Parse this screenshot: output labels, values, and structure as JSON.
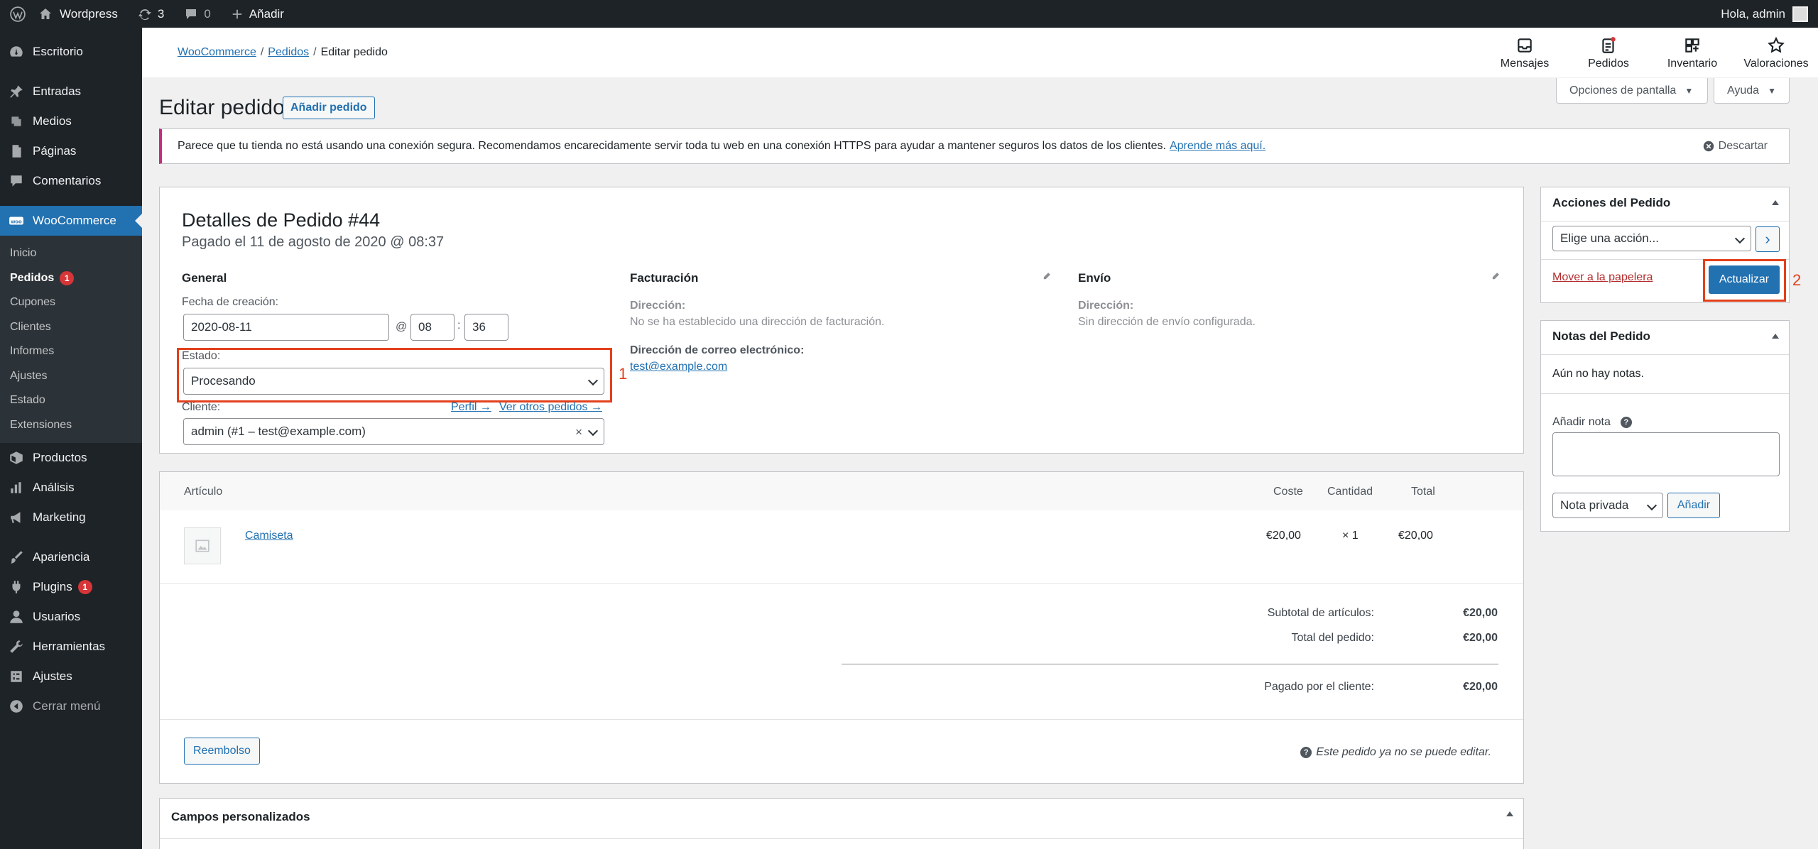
{
  "adminbar": {
    "site_name": "Wordpress",
    "updates_count": "3",
    "comments_count": "0",
    "new_label": "Añadir",
    "greeting": "Hola, admin"
  },
  "sidebar": {
    "items": [
      {
        "label": "Escritorio",
        "icon": "dashboard-icon"
      },
      {
        "label": "Entradas",
        "icon": "pin-icon"
      },
      {
        "label": "Medios",
        "icon": "media-icon"
      },
      {
        "label": "Páginas",
        "icon": "page-icon"
      },
      {
        "label": "Comentarios",
        "icon": "comment-icon"
      },
      {
        "label": "WooCommerce",
        "icon": "woo-icon"
      },
      {
        "label": "Productos",
        "icon": "box-icon"
      },
      {
        "label": "Análisis",
        "icon": "chart-icon"
      },
      {
        "label": "Marketing",
        "icon": "megaphone-icon"
      },
      {
        "label": "Apariencia",
        "icon": "brush-icon"
      },
      {
        "label": "Plugins",
        "icon": "plug-icon",
        "badge": "1"
      },
      {
        "label": "Usuarios",
        "icon": "user-icon"
      },
      {
        "label": "Herramientas",
        "icon": "wrench-icon"
      },
      {
        "label": "Ajustes",
        "icon": "settings-icon"
      },
      {
        "label": "Cerrar menú",
        "icon": "collapse-icon"
      }
    ],
    "woo_submenu": [
      {
        "label": "Inicio"
      },
      {
        "label": "Pedidos",
        "badge": "1"
      },
      {
        "label": "Cupones"
      },
      {
        "label": "Clientes"
      },
      {
        "label": "Informes"
      },
      {
        "label": "Ajustes"
      },
      {
        "label": "Estado"
      },
      {
        "label": "Extensiones"
      }
    ]
  },
  "header": {
    "breadcrumb": [
      "WooCommerce",
      "Pedidos",
      "Editar pedido"
    ],
    "tools": [
      "Mensajes",
      "Pedidos",
      "Inventario",
      "Valoraciones"
    ],
    "screen_options": "Opciones de pantalla",
    "help": "Ayuda"
  },
  "page": {
    "title": "Editar pedido",
    "add_order": "Añadir pedido"
  },
  "notice": {
    "text": "Parece que tu tienda no está usando una conexión segura. Recomendamos encarecidamente servir toda tu web en una conexión HTTPS para ayudar a mantener seguros los datos de los clientes.",
    "link": "Aprende más aquí.",
    "dismiss": "Descartar"
  },
  "order": {
    "heading": "Detalles de Pedido #44",
    "paid": "Pagado el 11 de agosto de 2020 @ 08:37",
    "general": {
      "title": "General",
      "created_label": "Fecha de creación:",
      "date": "2020-08-11",
      "at": "@",
      "hour": "08",
      "colon": ":",
      "minute": "36",
      "status_label": "Estado:",
      "status_value": "Procesando",
      "customer_label": "Cliente:",
      "profile_link": "Perfil →",
      "other_orders_link": "Ver otros pedidos →",
      "customer_value": "admin (#1 – test@example.com)",
      "clear": "×"
    },
    "billing": {
      "title": "Facturación",
      "address_label": "Dirección:",
      "address_value": "No se ha establecido una dirección de facturación.",
      "email_label": "Dirección de correo electrónico:",
      "email_value": "test@example.com"
    },
    "shipping": {
      "title": "Envío",
      "address_label": "Dirección:",
      "address_value": "Sin dirección de envío configurada."
    }
  },
  "annotations": {
    "one": "1",
    "two": "2"
  },
  "items": {
    "headers": {
      "item": "Artículo",
      "cost": "Coste",
      "qty": "Cantidad",
      "total": "Total"
    },
    "rows": [
      {
        "name": "Camiseta",
        "cost": "€20,00",
        "qty": "× 1",
        "total": "€20,00"
      }
    ],
    "totals": {
      "subtotal_label": "Subtotal de artículos:",
      "subtotal_value": "€20,00",
      "order_total_label": "Total del pedido:",
      "order_total_value": "€20,00",
      "paid_label": "Pagado por el cliente:",
      "paid_value": "€20,00"
    },
    "refund": "Reembolso",
    "no_edit": "Este pedido ya no se puede editar."
  },
  "custom_fields": {
    "title": "Campos personalizados"
  },
  "actions": {
    "title": "Acciones del Pedido",
    "select_placeholder": "Elige una acción...",
    "go": "›",
    "trash": "Mover a la papelera",
    "update": "Actualizar"
  },
  "notes": {
    "title": "Notas del Pedido",
    "empty": "Aún no hay notas.",
    "add_label": "Añadir nota",
    "help": "?",
    "type": "Nota privada",
    "add_button": "Añadir"
  },
  "colors": {
    "accent": "#2271b1",
    "highlight": "#e2401c",
    "sidebar": "#1d2327"
  }
}
